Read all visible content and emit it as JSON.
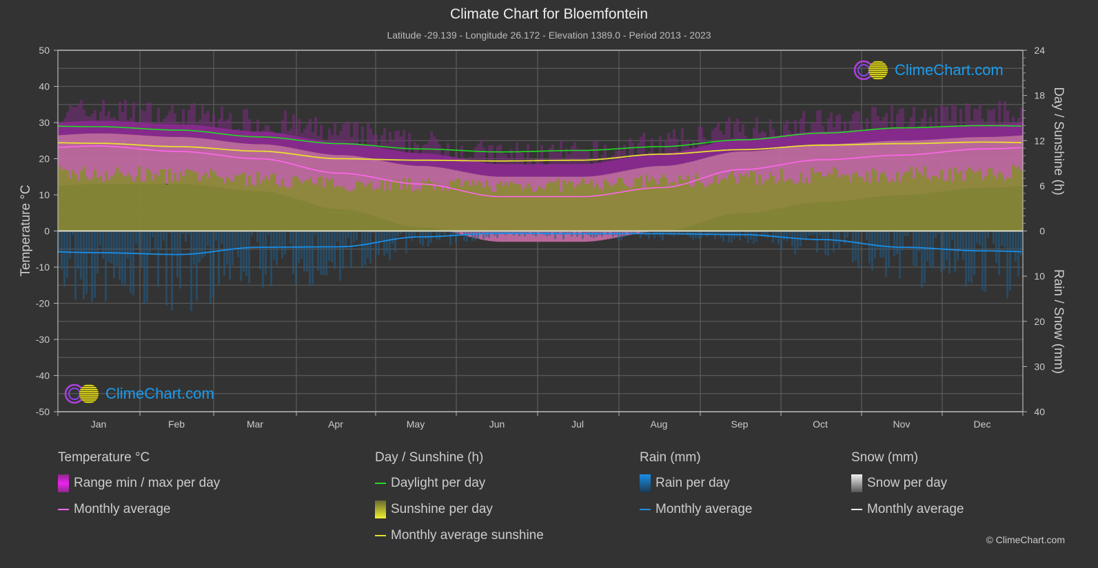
{
  "header": {
    "title": "Climate Chart for Bloemfontein",
    "subtitle": "Latitude -29.139 - Longitude 26.172 - Elevation 1389.0 - Period 2013 - 2023"
  },
  "logo_text": "ClimeChart.com",
  "copyright": "© ClimeChart.com",
  "legend": {
    "temperature": {
      "title": "Temperature °C",
      "range_label": "Range min / max per day",
      "avg_label": "Monthly average"
    },
    "sunshine": {
      "title": "Day / Sunshine (h)",
      "daylight_label": "Daylight per day",
      "sunshine_label": "Sunshine per day",
      "avg_label": "Monthly average sunshine"
    },
    "rain": {
      "title": "Rain (mm)",
      "per_day_label": "Rain per day",
      "avg_label": "Monthly average"
    },
    "snow": {
      "title": "Snow (mm)",
      "per_day_label": "Snow per day",
      "avg_label": "Monthly average"
    }
  },
  "colors": {
    "background": "#333333",
    "temp_avg": "#ff66ee",
    "daylight": "#22dd22",
    "sunshine_avg": "#e8e030",
    "rain_avg": "#1a8fe8",
    "range_fill": "#c040c0",
    "sunshine_fill": "#8a8a35",
    "rain_fill": "#1f5d8a",
    "snow": "#ffffff"
  },
  "chart_data": {
    "type": "area",
    "title": "Climate Chart for Bloemfontein",
    "categories": [
      "Jan",
      "Feb",
      "Mar",
      "Apr",
      "May",
      "Jun",
      "Jul",
      "Aug",
      "Sep",
      "Oct",
      "Nov",
      "Dec"
    ],
    "axes": {
      "left": {
        "label": "Temperature °C",
        "range": [
          -50,
          50
        ],
        "ticks": [
          "50",
          "40",
          "30",
          "20",
          "10",
          "0",
          "-10",
          "-20",
          "-30",
          "-40",
          "-50"
        ]
      },
      "right_top": {
        "label": "Day / Sunshine (h)",
        "range": [
          0,
          24
        ],
        "ticks": [
          "24",
          "18",
          "12",
          "6",
          "0"
        ]
      },
      "right_bottom": {
        "label": "Rain / Snow (mm)",
        "range": [
          0,
          40
        ],
        "ticks": [
          "0",
          "10",
          "20",
          "30",
          "40"
        ]
      }
    },
    "grid": true,
    "legend_position": "bottom",
    "series": [
      {
        "name": "Temperature monthly average (°C)",
        "axis": "left",
        "values": [
          23.5,
          22.0,
          20.0,
          16.0,
          13.0,
          9.5,
          9.5,
          12.0,
          17.0,
          19.7,
          21.0,
          22.7
        ]
      },
      {
        "name": "Temperature daily max band (°C)",
        "axis": "left",
        "values": [
          31,
          30,
          28,
          25,
          22,
          19,
          19,
          22,
          26,
          28,
          29,
          30
        ]
      },
      {
        "name": "Temperature daily min band (°C)",
        "axis": "left",
        "values": [
          15,
          15,
          13,
          8,
          3,
          -1,
          -1,
          2,
          7,
          10,
          12,
          14
        ]
      },
      {
        "name": "Daylight per day (h)",
        "axis": "right_top",
        "values": [
          13.85,
          13.4,
          12.5,
          11.6,
          10.9,
          10.5,
          10.7,
          11.2,
          12.1,
          13.0,
          13.7,
          14.0
        ]
      },
      {
        "name": "Monthly average sunshine (h)",
        "axis": "right_top",
        "values": [
          11.65,
          11.2,
          10.6,
          9.6,
          9.4,
          9.3,
          9.4,
          10.2,
          10.8,
          11.4,
          11.6,
          11.8
        ]
      },
      {
        "name": "Rain monthly average (mm)",
        "axis": "right_bottom",
        "values": [
          4.8,
          5.2,
          3.6,
          3.5,
          1.3,
          0.5,
          0.6,
          0.6,
          0.8,
          1.9,
          3.6,
          4.4
        ]
      },
      {
        "name": "Snow monthly average (mm)",
        "axis": "right_bottom",
        "values": [
          0,
          0,
          0,
          0,
          0,
          0,
          0,
          0,
          0,
          0,
          0,
          0
        ]
      }
    ]
  }
}
